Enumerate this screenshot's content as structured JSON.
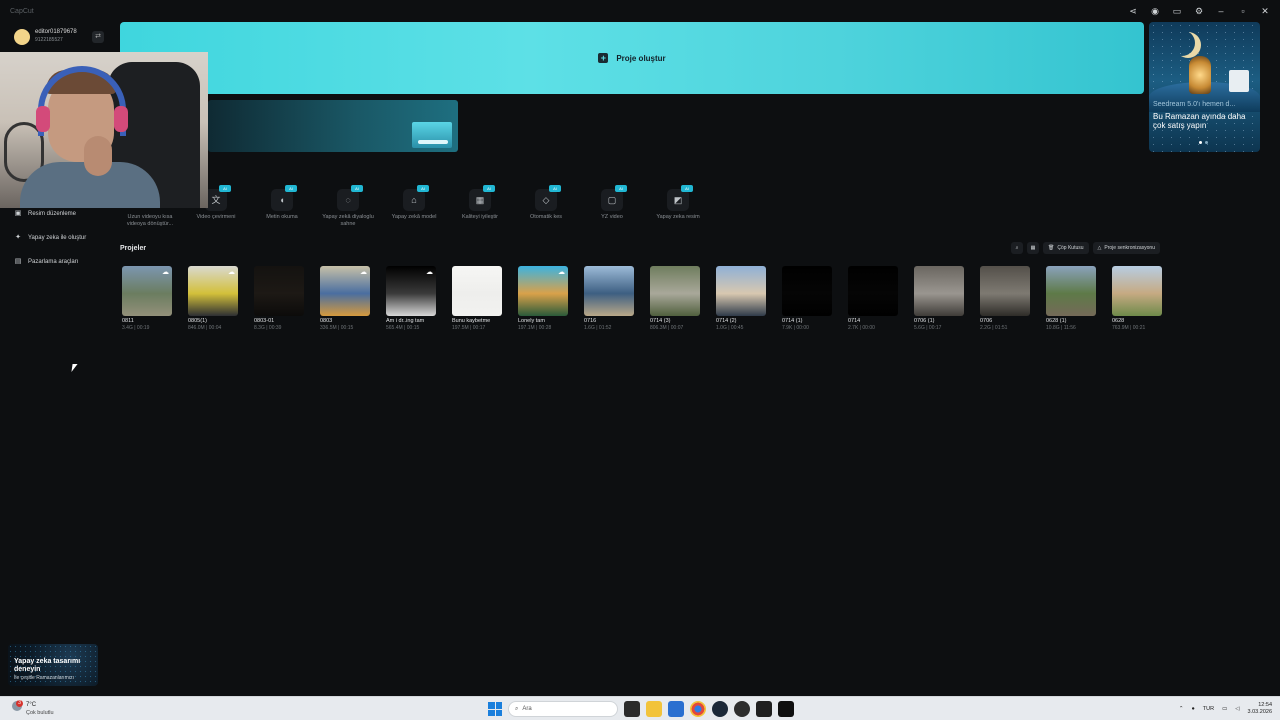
{
  "app": {
    "title": "CapCut"
  },
  "window_controls": [
    "share-icon",
    "help-icon",
    "layout-icon",
    "settings-icon",
    "minimize-icon",
    "maximize-icon",
    "close-icon"
  ],
  "account": {
    "name": "editor01879678",
    "id": "9122185527"
  },
  "sidebar": {
    "items": [
      {
        "label": "Resim düzenleme",
        "icon": "image-edit-icon"
      },
      {
        "label": "Yapay zeka ile oluştur",
        "icon": "sparkle-icon"
      },
      {
        "label": "Pazarlama araçları",
        "icon": "marketing-icon"
      }
    ],
    "promo": {
      "title": "Yapay zeka tasarımı deneyin",
      "subtitle": "İle çeşitle Ramazanlarımızı"
    }
  },
  "main": {
    "create_label": "Proje oluştur",
    "ad": {
      "small": "Seedream 5.0'ı hemen d...",
      "title": "Bu Ramazan ayında daha çok satış yapın"
    },
    "tools": [
      {
        "label": "Uzun videoyu kısa videoya dönüştür...",
        "icon": "clip-icon",
        "badge": "AI"
      },
      {
        "label": "Video çevirmeni",
        "icon": "translate-icon",
        "badge": "AI"
      },
      {
        "label": "Metin okuma",
        "icon": "voice-icon",
        "badge": "AI"
      },
      {
        "label": "Yapay zekâ diyaloglu sahne",
        "icon": "dialog-icon",
        "badge": "AI"
      },
      {
        "label": "Yapay zekâ model",
        "icon": "shirt-icon",
        "badge": "AI"
      },
      {
        "label": "Kaliteyi iyileştir",
        "icon": "hd-icon",
        "badge": "AI"
      },
      {
        "label": "Otomatik kes",
        "icon": "eraser-icon",
        "badge": "AI"
      },
      {
        "label": "YZ video",
        "icon": "ai-video-icon",
        "badge": "AI"
      },
      {
        "label": "Yapay zeka resim",
        "icon": "ai-image-icon",
        "badge": "AI"
      }
    ],
    "projects_title": "Projeler",
    "project_actions": {
      "trash": "Çöp Kutusu",
      "sync": "Proje senkronizasyonu"
    },
    "projects": [
      {
        "name": "0811",
        "meta": "3.4G | 00:19",
        "cloud": true,
        "colors": [
          "#7c96b0",
          "#6b7d60",
          "#93907a"
        ]
      },
      {
        "name": "0805(1)",
        "meta": "846.0M | 00:04",
        "cloud": true,
        "colors": [
          "#d9d9d0",
          "#d3c03a",
          "#2d2f33"
        ]
      },
      {
        "name": "0803-01",
        "meta": "8.3G | 00:39",
        "cloud": false,
        "colors": [
          "#141210",
          "#1d1915",
          "#0c0b0a"
        ]
      },
      {
        "name": "0803",
        "meta": "336.5M | 00:15",
        "cloud": true,
        "colors": [
          "#c7c0a8",
          "#4a6ea0",
          "#d59a3e"
        ]
      },
      {
        "name": "Am i dr..ing tam",
        "meta": "565.4M | 00:15",
        "cloud": true,
        "colors": [
          "#000000",
          "#3a3a3a",
          "#d8d8d8"
        ]
      },
      {
        "name": "Bunu kaybetme",
        "meta": "197.5M | 00:17",
        "cloud": false,
        "colors": [
          "#f6f6f4",
          "#eeeeec",
          "#f2f2f0"
        ]
      },
      {
        "name": "Lonely tam",
        "meta": "197.1M | 00:28",
        "cloud": true,
        "colors": [
          "#3cb3e0",
          "#d9a14a",
          "#2a5a3a"
        ]
      },
      {
        "name": "0716",
        "meta": "1.6G | 01:52",
        "cloud": false,
        "colors": [
          "#9dbbd8",
          "#3d5f82",
          "#b9a888"
        ]
      },
      {
        "name": "0714 (3)",
        "meta": "806.3M | 00:07",
        "cloud": false,
        "colors": [
          "#6f7d5e",
          "#a9a89a",
          "#50603e"
        ]
      },
      {
        "name": "0714 (2)",
        "meta": "1.0G | 00:45",
        "cloud": false,
        "colors": [
          "#8fb0d6",
          "#d8c8b0",
          "#2f3b4a"
        ]
      },
      {
        "name": "0714 (1)",
        "meta": "7.9K | 00:00",
        "cloud": false,
        "colors": [
          "#000000",
          "#050505",
          "#000000"
        ]
      },
      {
        "name": "0714",
        "meta": "2.7K | 00:00",
        "cloud": false,
        "colors": [
          "#000000",
          "#050505",
          "#000000"
        ]
      },
      {
        "name": "0706 (1)",
        "meta": "5.6G | 00:17",
        "cloud": false,
        "colors": [
          "#6a6660",
          "#9a9690",
          "#3f3c38"
        ]
      },
      {
        "name": "0706",
        "meta": "2.2G | 01:51",
        "cloud": false,
        "colors": [
          "#54504a",
          "#7e7a72",
          "#2e2c28"
        ]
      },
      {
        "name": "0628 (1)",
        "meta": "10.8G | 11:56",
        "cloud": false,
        "colors": [
          "#8aa2bc",
          "#5e7a48",
          "#746a58"
        ]
      },
      {
        "name": "0628",
        "meta": "763.9M | 00:21",
        "cloud": false,
        "colors": [
          "#b7cde2",
          "#c6aa82",
          "#6e8a4a"
        ]
      }
    ]
  },
  "taskbar": {
    "weather": {
      "temp": "7°C",
      "desc": "Çok bulutlu",
      "badge": "3"
    },
    "search_placeholder": "Ara",
    "apps": [
      "files-icon",
      "explorer-icon",
      "store-icon",
      "chrome-icon",
      "steam-icon",
      "game-icon",
      "terminal-icon",
      "capcut-icon"
    ],
    "lang": "TUR",
    "time": "12:54",
    "date": "3.03.2026"
  },
  "colors": {
    "accent": "#3fd6de",
    "background": "#0d0f11",
    "badge": "#21b7d3"
  }
}
